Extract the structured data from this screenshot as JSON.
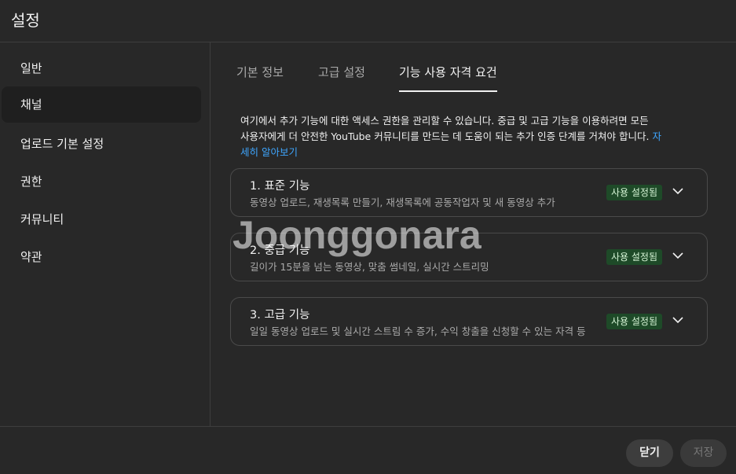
{
  "header": {
    "title": "설정"
  },
  "sidebar": {
    "items": [
      {
        "label": "일반"
      },
      {
        "label": "채널"
      },
      {
        "label": "업로드 기본 설정"
      },
      {
        "label": "권한"
      },
      {
        "label": "커뮤니티"
      },
      {
        "label": "약관"
      }
    ],
    "active_index": 1
  },
  "tabs": [
    {
      "label": "기본 정보"
    },
    {
      "label": "고급 설정"
    },
    {
      "label": "기능 사용 자격 요건"
    }
  ],
  "description": {
    "line1": "여기에서 추가 기능에 대한 액세스 권한을 관리할 수 있습니다. 중급 및 고급 기능을 이용하려면 모든",
    "line2": "사용자에게 더 안전한 YouTube 커뮤니티를 만드는 데 도움이 되는 추가 인증 단계를 거쳐야 합니다.",
    "learn_more_a": "자",
    "learn_more_b": "세히 알아보기"
  },
  "features": [
    {
      "title": "1. 표준 기능",
      "subtitle": "동영상 업로드, 재생목록 만들기, 재생목록에 공동작업자 및 새 동영상 추가",
      "status": "사용 설정됨"
    },
    {
      "title": "2. 중급 기능",
      "subtitle": "길이가 15분을 넘는 동영상, 맞춤 썸네일, 실시간 스트리밍",
      "status": "사용 설정됨"
    },
    {
      "title": "3. 고급 기능",
      "subtitle": "일일 동영상 업로드 및 실시간 스트림 수 증가, 수익 창출을 신청할 수 있는 자격 등",
      "status": "사용 설정됨"
    }
  ],
  "watermark": "Joonggonara",
  "footer": {
    "close_label": "닫기",
    "save_label": "저장"
  },
  "colors": {
    "background": "#282828",
    "link": "#3ea6ff",
    "badge_bg": "#1e4a28"
  }
}
